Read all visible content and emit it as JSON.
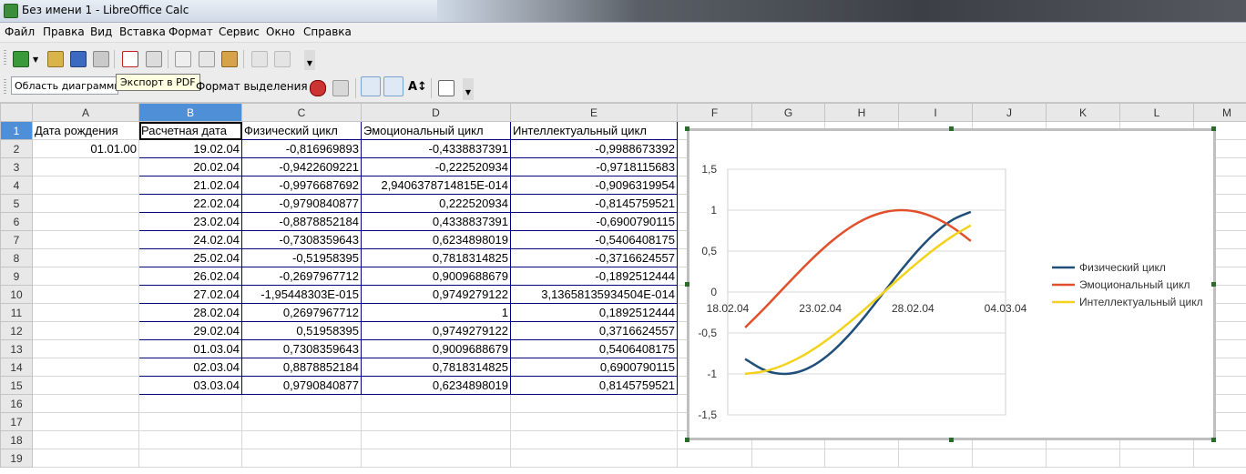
{
  "window": {
    "title": "Без имени 1 - LibreOffice Calc"
  },
  "menu": [
    "Файл",
    "Правка",
    "Вид",
    "Вставка",
    "Формат",
    "Сервис",
    "Окно",
    "Справка"
  ],
  "toolbar": {
    "object_box": "Область диаграммы",
    "tooltip": "Экспорт в PDF",
    "format_selection": "Формат выделения"
  },
  "sheet": {
    "columns": [
      "A",
      "B",
      "C",
      "D",
      "E",
      "F",
      "G",
      "H",
      "I",
      "J",
      "K",
      "L",
      "M"
    ],
    "selected_column": "B",
    "rows": [
      [
        "Дата рождения",
        "Расчетная дата",
        "Физический цикл",
        "Эмоциональный цикл",
        "Интеллектуальный цикл"
      ],
      [
        "01.01.00",
        "19.02.04",
        "-0,816969893",
        "-0,4338837391",
        "-0,9988673392"
      ],
      [
        "",
        "20.02.04",
        "-0,9422609221",
        "-0,222520934",
        "-0,9718115683"
      ],
      [
        "",
        "21.02.04",
        "-0,9976687692",
        "2,9406378714815E-014",
        "-0,9096319954"
      ],
      [
        "",
        "22.02.04",
        "-0,9790840877",
        "0,222520934",
        "-0,8145759521"
      ],
      [
        "",
        "23.02.04",
        "-0,8878852184",
        "0,4338837391",
        "-0,6900790115"
      ],
      [
        "",
        "24.02.04",
        "-0,7308359643",
        "0,6234898019",
        "-0,5406408175"
      ],
      [
        "",
        "25.02.04",
        "-0,51958395",
        "0,7818314825",
        "-0,3716624557"
      ],
      [
        "",
        "26.02.04",
        "-0,2697967712",
        "0,9009688679",
        "-0,1892512444"
      ],
      [
        "",
        "27.02.04",
        "-1,95448303E-015",
        "0,9749279122",
        "3,13658135934504E-014"
      ],
      [
        "",
        "28.02.04",
        "0,2697967712",
        "1",
        "0,1892512444"
      ],
      [
        "",
        "29.02.04",
        "0,51958395",
        "0,9749279122",
        "0,3716624557"
      ],
      [
        "",
        "01.03.04",
        "0,7308359643",
        "0,9009688679",
        "0,5406408175"
      ],
      [
        "",
        "02.03.04",
        "0,8878852184",
        "0,7818314825",
        "0,6900790115"
      ],
      [
        "",
        "03.03.04",
        "0,9790840877",
        "0,6234898019",
        "0,8145759521"
      ],
      [
        "",
        "",
        "",
        "",
        ""
      ],
      [
        "",
        "",
        "",
        "",
        ""
      ],
      [
        "",
        "",
        "",
        "",
        ""
      ],
      [
        "",
        "",
        "",
        "",
        ""
      ]
    ]
  },
  "chart_data": {
    "type": "line",
    "x": [
      "19.02.04",
      "20.02.04",
      "21.02.04",
      "22.02.04",
      "23.02.04",
      "24.02.04",
      "25.02.04",
      "26.02.04",
      "27.02.04",
      "28.02.04",
      "29.02.04",
      "01.03.04",
      "02.03.04",
      "03.03.04"
    ],
    "x_tick_labels": [
      "18.02.04",
      "23.02.04",
      "28.02.04",
      "04.03.04"
    ],
    "ylim": [
      -1.5,
      1.5
    ],
    "y_tick_labels": [
      "1,5",
      "1",
      "0,5",
      "0",
      "-0,5",
      "-1",
      "-1,5"
    ],
    "grid": "horizontal",
    "legend": "right",
    "series": [
      {
        "name": "Физический цикл",
        "color": "#1f4e79",
        "values": [
          -0.817,
          -0.9423,
          -0.9977,
          -0.9791,
          -0.8879,
          -0.7308,
          -0.5196,
          -0.2698,
          0.0,
          0.2698,
          0.5196,
          0.7308,
          0.8879,
          0.9791
        ]
      },
      {
        "name": "Эмоциональный цикл",
        "color": "#e0502a",
        "values": [
          -0.4339,
          -0.2225,
          0.0,
          0.2225,
          0.4339,
          0.6235,
          0.7818,
          0.901,
          0.9749,
          1.0,
          0.9749,
          0.901,
          0.7818,
          0.6235
        ]
      },
      {
        "name": "Интеллектуальный цикл",
        "color": "#f2d21b",
        "values": [
          -0.9989,
          -0.9718,
          -0.9096,
          -0.8146,
          -0.6901,
          -0.5406,
          -0.3717,
          -0.1893,
          0.0,
          0.1893,
          0.3717,
          0.5406,
          0.6901,
          0.8146
        ]
      }
    ]
  }
}
